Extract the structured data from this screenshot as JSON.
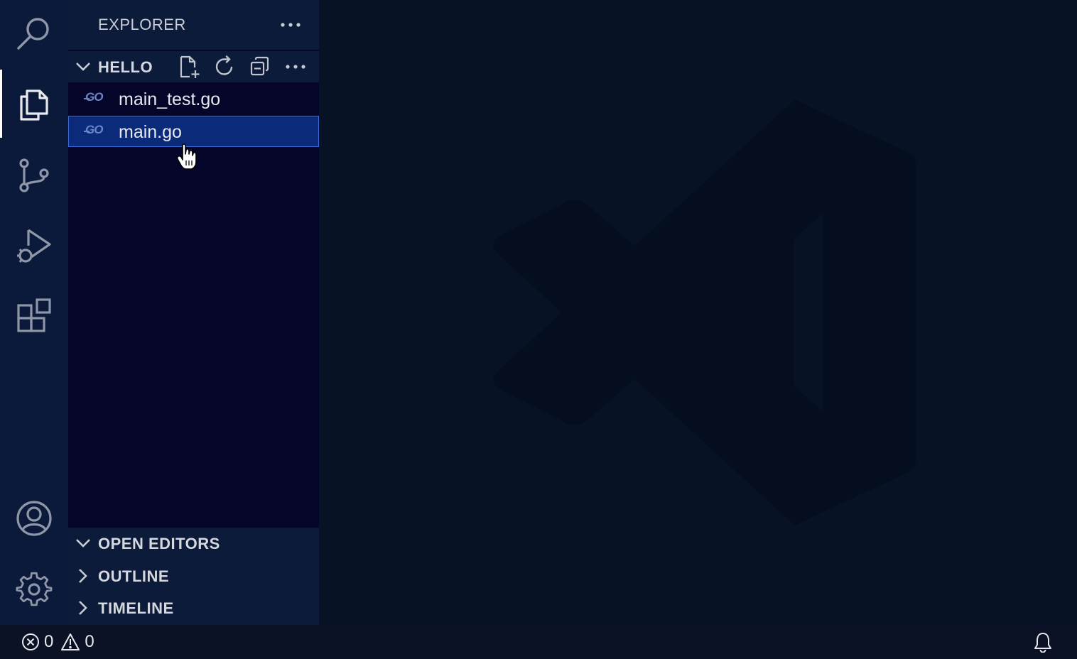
{
  "sidebar": {
    "title": "EXPLORER",
    "folder": {
      "label": "HELLO",
      "files": [
        {
          "icon": "go-file-icon",
          "icon_text": "GO",
          "name": "main_test.go",
          "selected": false
        },
        {
          "icon": "go-file-icon",
          "icon_text": "GO",
          "name": "main.go",
          "selected": true
        }
      ]
    },
    "sections": [
      {
        "label": "OPEN EDITORS",
        "expanded": true
      },
      {
        "label": "OUTLINE",
        "expanded": false
      },
      {
        "label": "TIMELINE",
        "expanded": false
      }
    ]
  },
  "activity_bar": {
    "items": [
      "search-icon",
      "explorer-icon",
      "source-control-icon",
      "run-debug-icon",
      "extensions-icon",
      "account-icon",
      "settings-gear-icon"
    ],
    "active": "explorer-icon"
  },
  "status_bar": {
    "errors": "0",
    "warnings": "0"
  },
  "colors": {
    "activity_bar": "#0b1a3a",
    "sidebar": "#050529",
    "editor": "#071224",
    "selection": "#0b2a79",
    "selection_border": "#3a6bd6"
  }
}
